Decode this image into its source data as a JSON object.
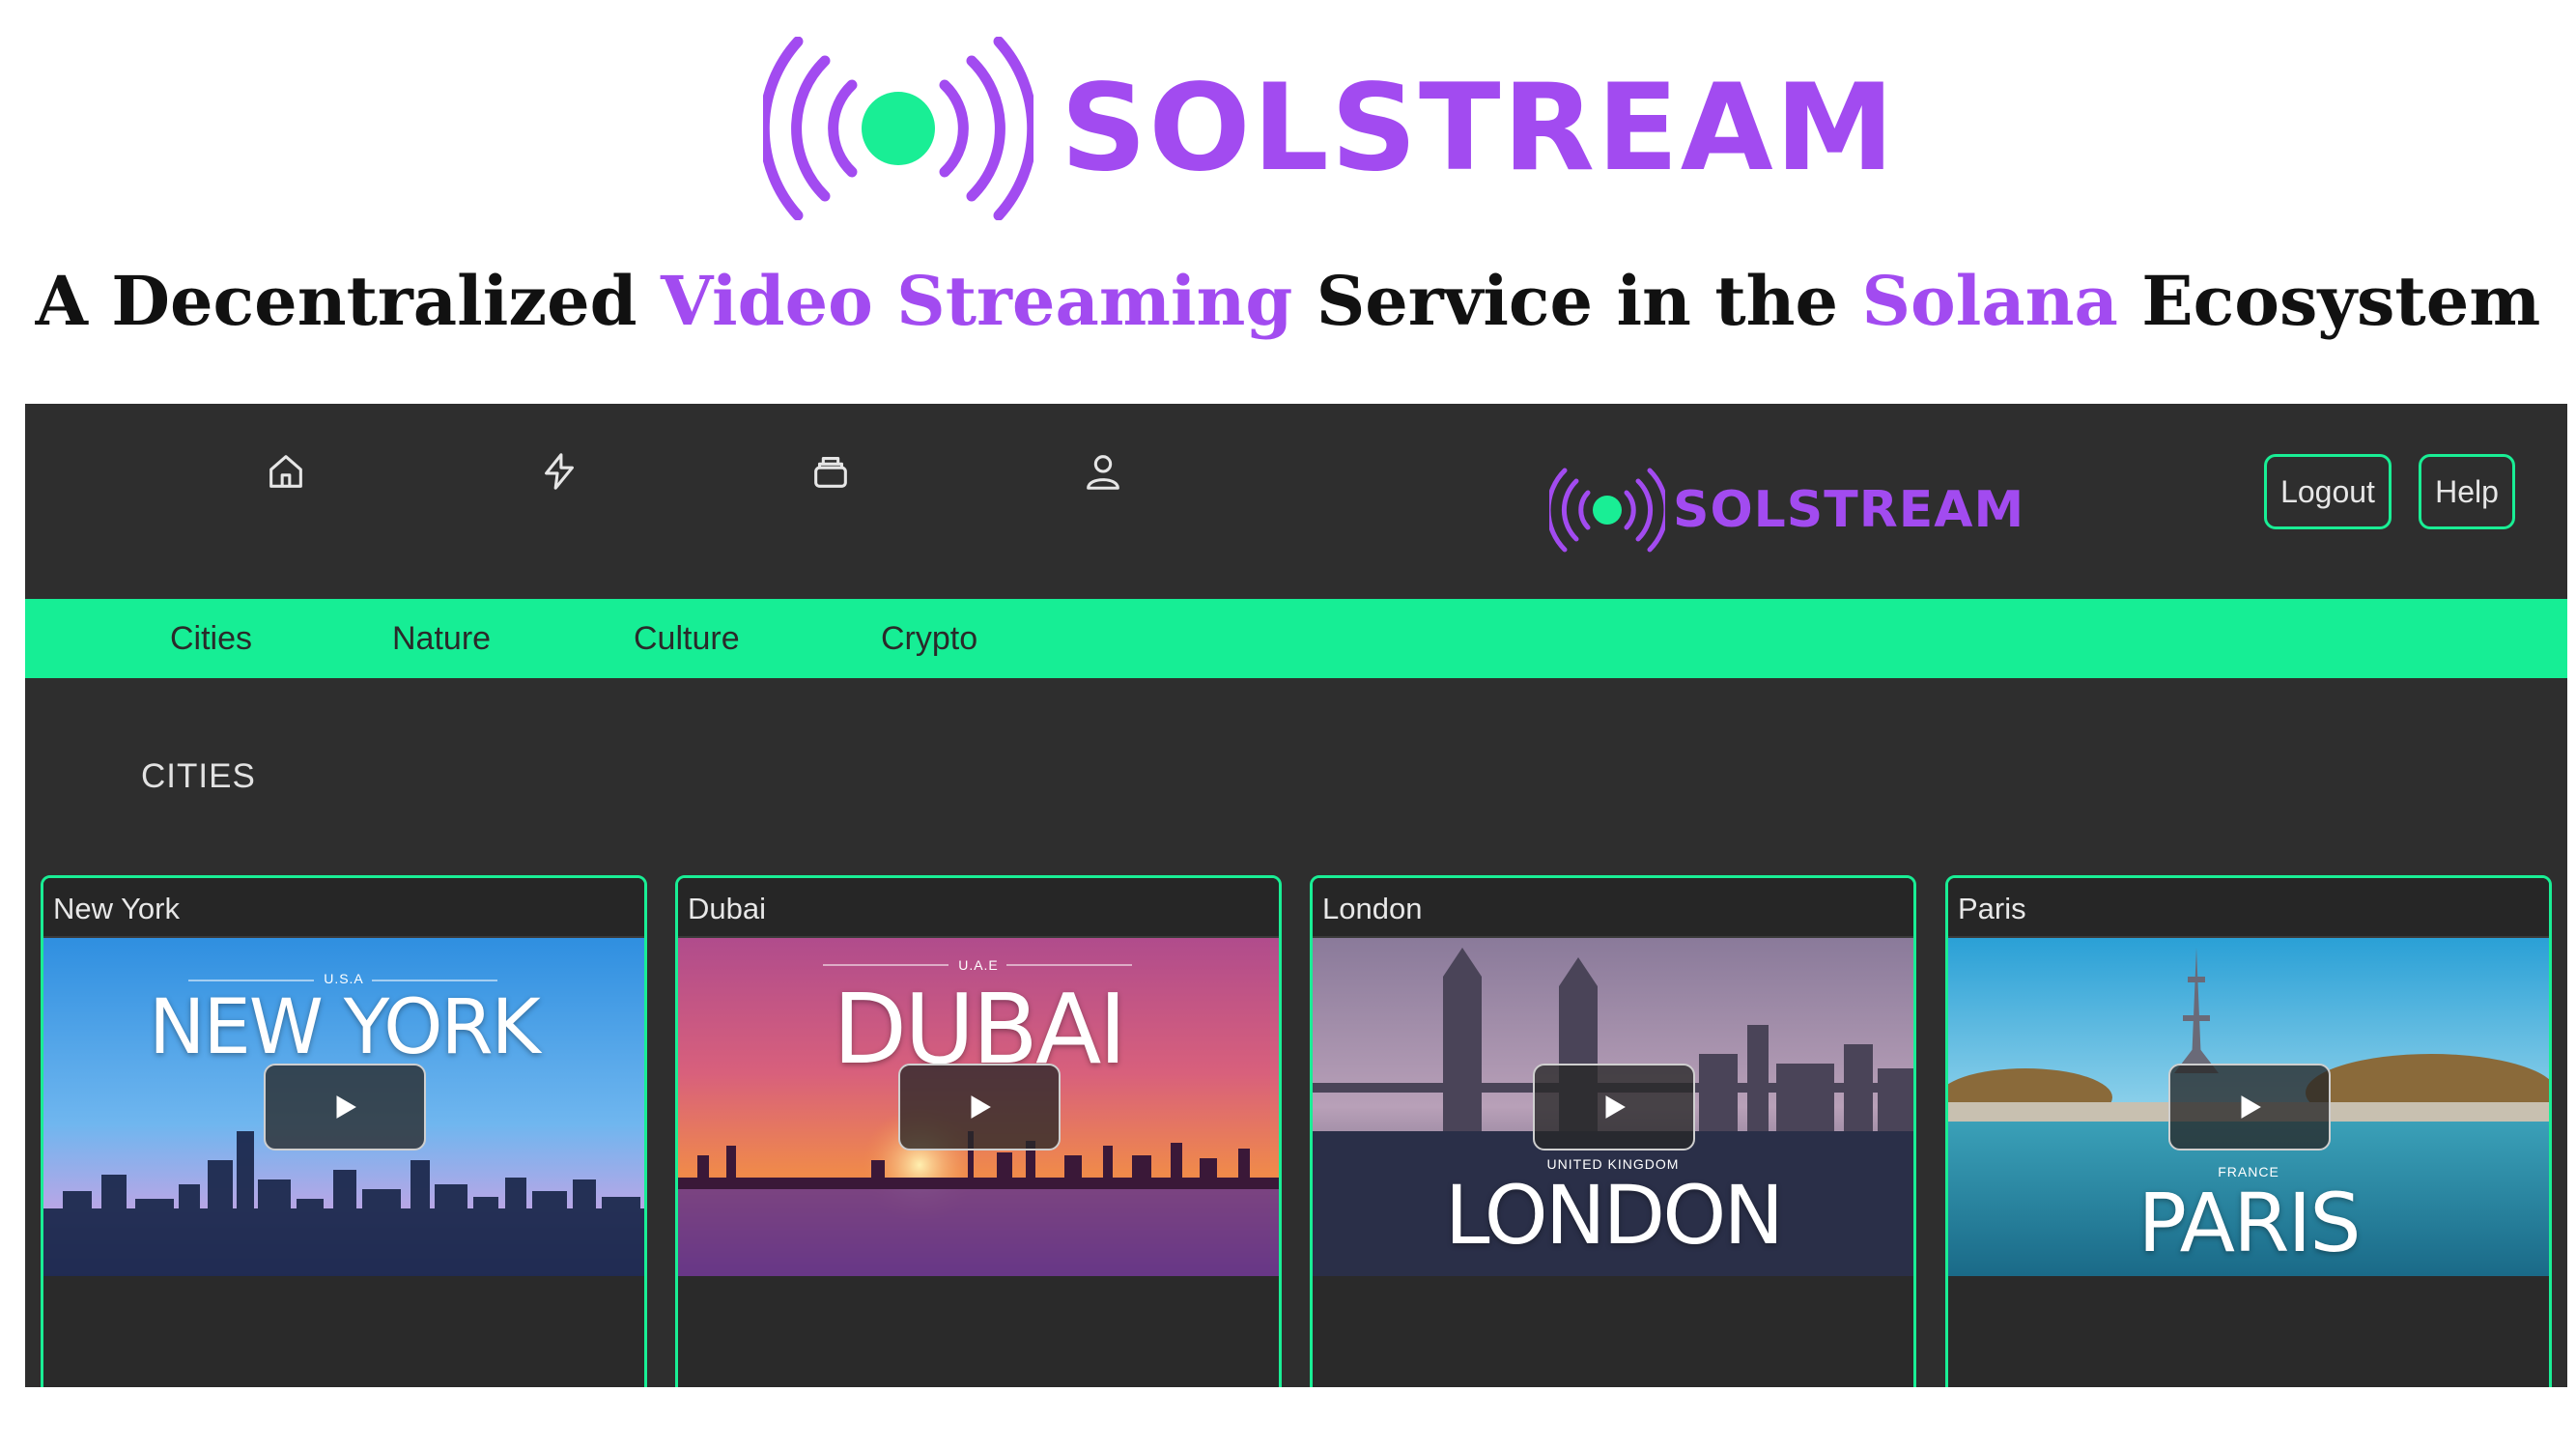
{
  "hero": {
    "brand": "SOLSTREAM",
    "tagline": {
      "part1": "A Decentralized ",
      "highlight1": "Video Streaming",
      "part2": " Service in the ",
      "highlight2": "Solana",
      "part3": " Ecosystem"
    }
  },
  "app": {
    "nav_icons": [
      "home-icon",
      "lightning-icon",
      "stack-icon",
      "user-icon"
    ],
    "brand": "SOLSTREAM",
    "buttons": {
      "logout": "Logout",
      "help": "Help"
    },
    "categories": [
      "Cities",
      "Nature",
      "Culture",
      "Crypto"
    ],
    "section_title": "CITIES",
    "videos": [
      {
        "title": "New York",
        "country": "U.S.A",
        "city": "NEW YORK"
      },
      {
        "title": "Dubai",
        "country": "U.A.E",
        "city": "DUBAI"
      },
      {
        "title": "London",
        "country": "UNITED KINGDOM",
        "city": "LONDON"
      },
      {
        "title": "Paris",
        "country": "FRANCE",
        "city": "PARIS"
      }
    ]
  },
  "colors": {
    "accent_purple": "#a24bf0",
    "accent_green": "#16ee95",
    "app_background": "#2e2e2e"
  }
}
